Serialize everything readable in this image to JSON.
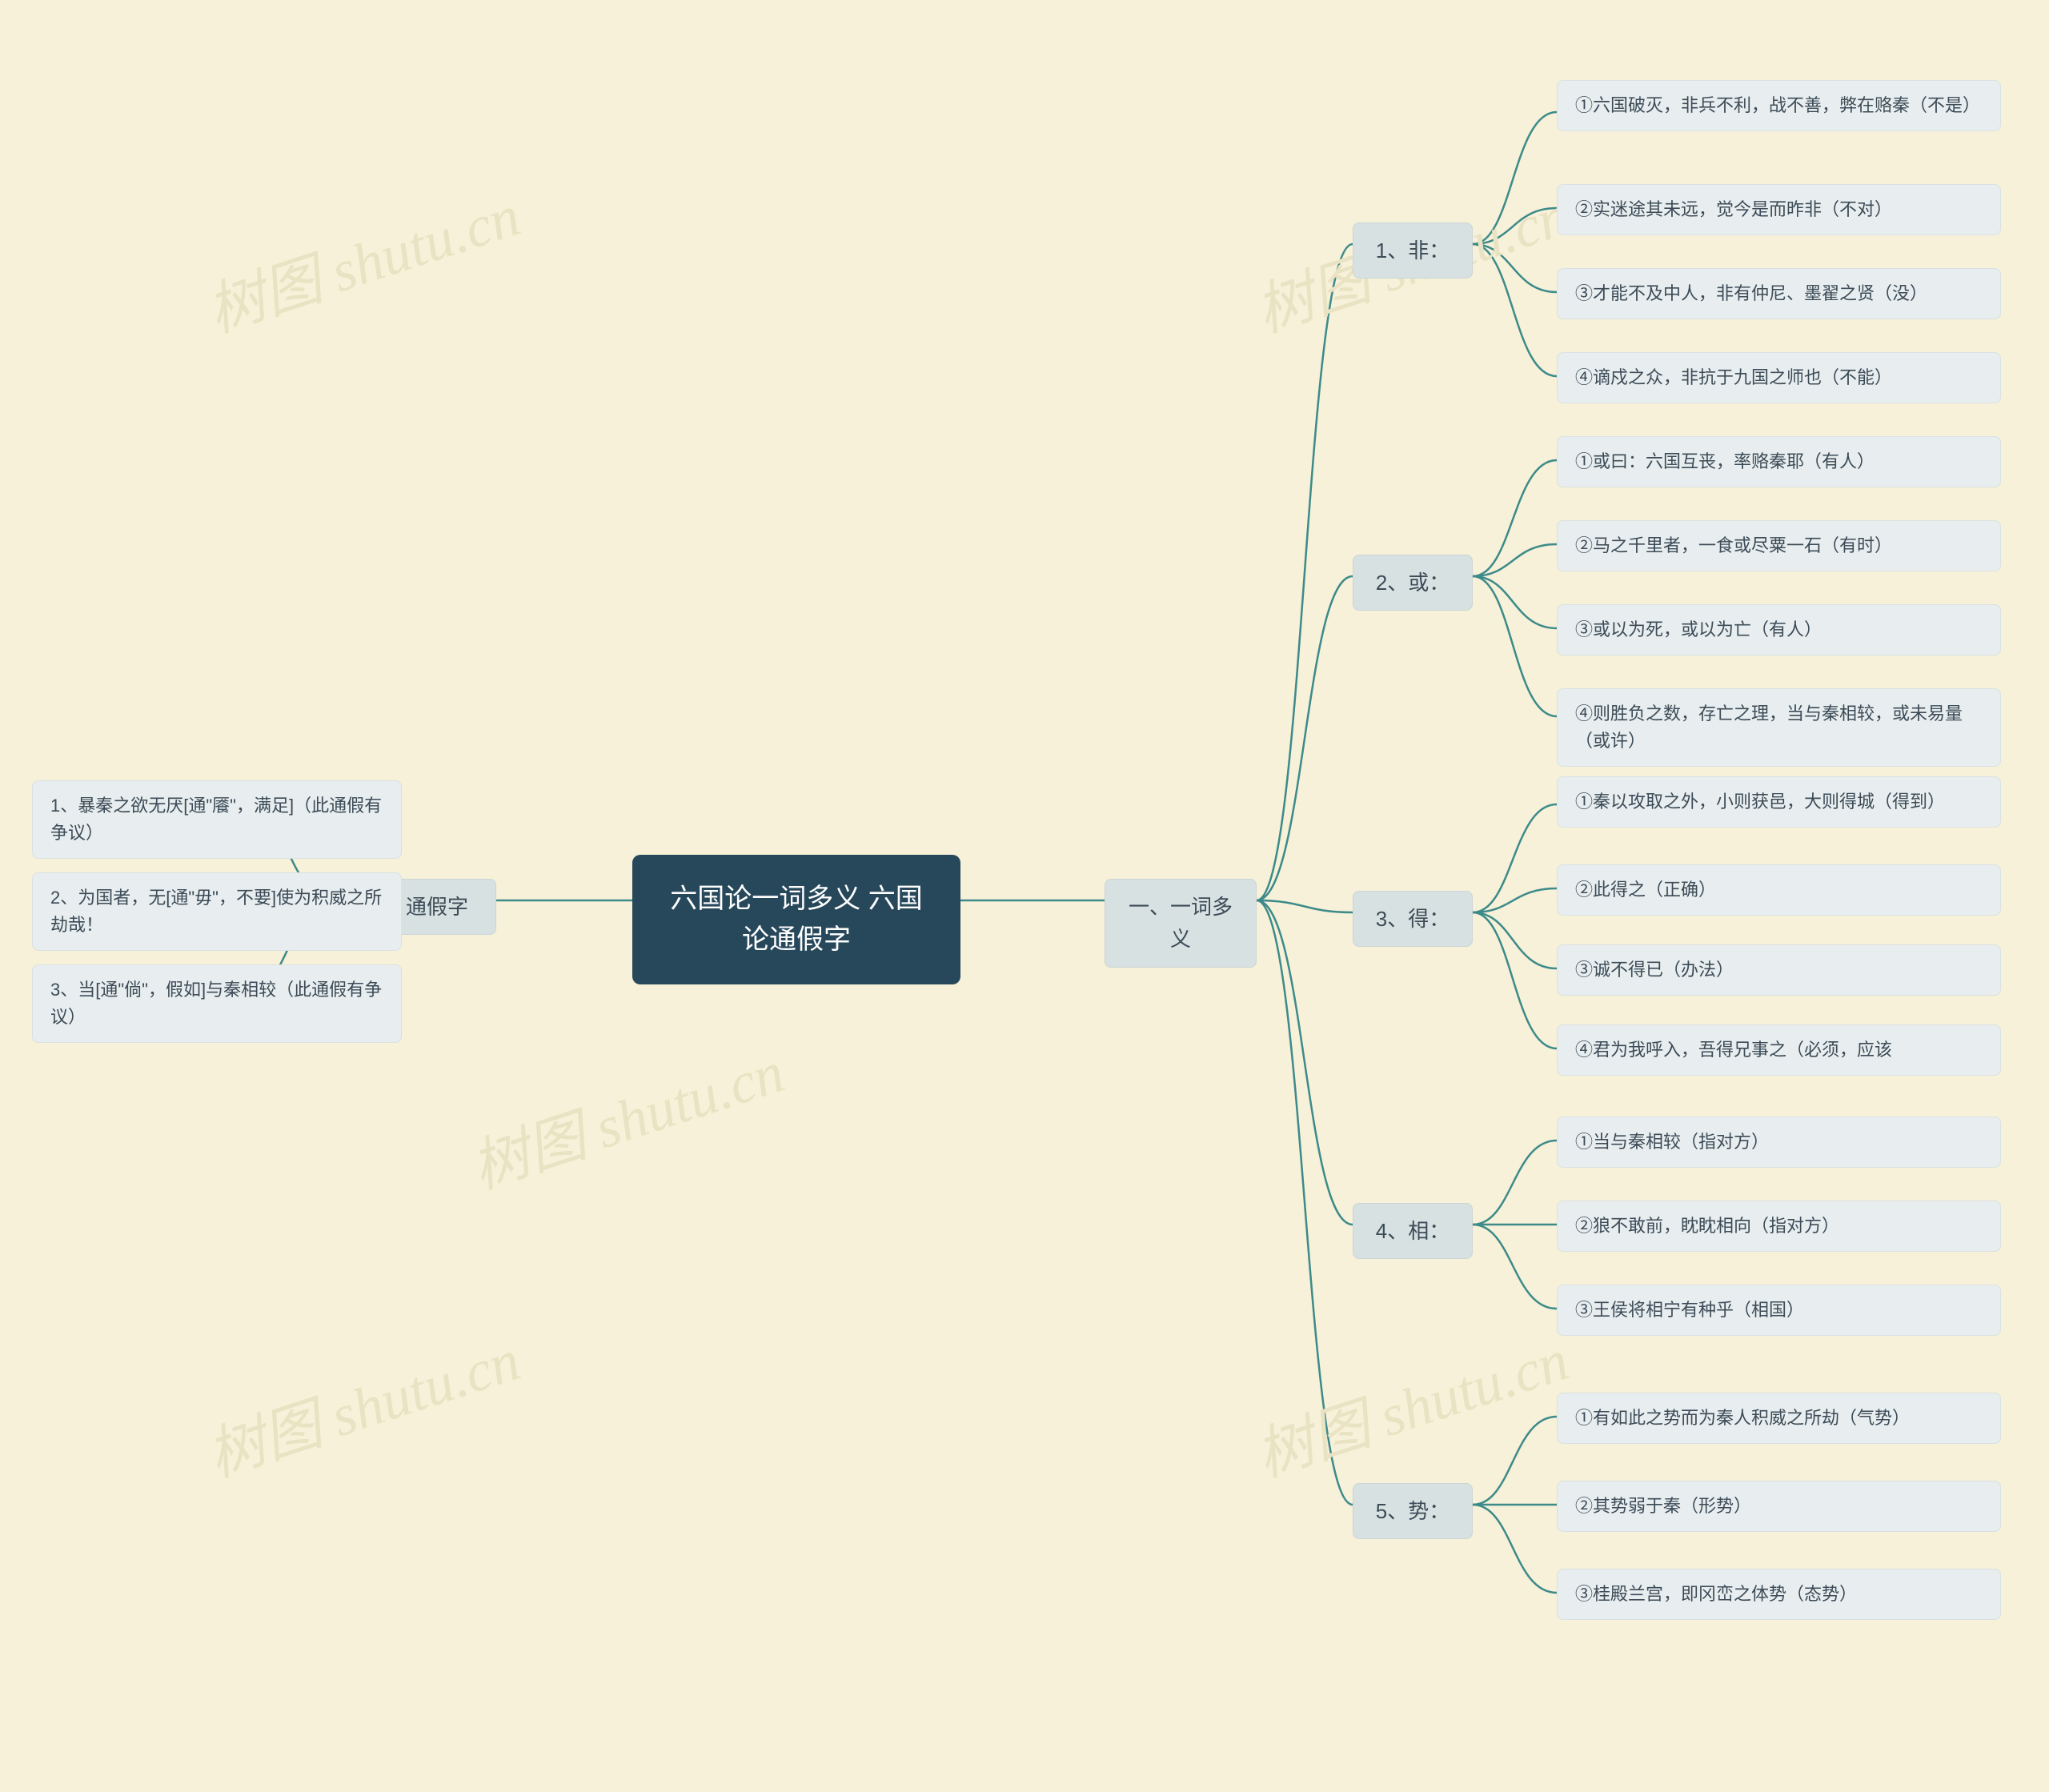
{
  "root_title": "六国论一词多义 六国论通假字",
  "watermark_text": "树图 shutu.cn",
  "branch_left": {
    "title": "二、通假字",
    "items": [
      "1、暴秦之欲无厌[通\"餍\"，满足]（此通假有争议）",
      "2、为国者，无[通\"毋\"，不要]使为积威之所劫哉！",
      "3、当[通\"倘\"，假如]与秦相较（此通假有争议）"
    ]
  },
  "branch_right": {
    "title": "一、一词多义",
    "groups": [
      {
        "label": "1、非：",
        "items": [
          "①六国破灭，非兵不利，战不善，弊在赂秦（不是）",
          "②实迷途其未远，觉今是而昨非（不对）",
          "③才能不及中人，非有仲尼、墨翟之贤（没）",
          "④谪戍之众，非抗于九国之师也（不能）"
        ]
      },
      {
        "label": "2、或：",
        "items": [
          "①或曰：六国互丧，率赂秦耶（有人）",
          "②马之千里者，一食或尽粟一石（有时）",
          "③或以为死，或以为亡（有人）",
          "④则胜负之数，存亡之理，当与秦相较，或未易量（或许）"
        ]
      },
      {
        "label": "3、得：",
        "items": [
          "①秦以攻取之外，小则获邑，大则得城（得到）",
          "②此得之（正确）",
          "③诚不得已（办法）",
          "④君为我呼入，吾得兄事之（必须，应该"
        ]
      },
      {
        "label": "4、相：",
        "items": [
          "①当与秦相较（指对方）",
          "②狼不敢前，眈眈相向（指对方）",
          "③王侯将相宁有种乎（相国）"
        ]
      },
      {
        "label": "5、势：",
        "items": [
          "①有如此之势而为秦人积威之所劫（气势）",
          "②其势弱于秦（形势）",
          "③桂殿兰宫，即冈峦之体势（态势）"
        ]
      }
    ]
  }
}
